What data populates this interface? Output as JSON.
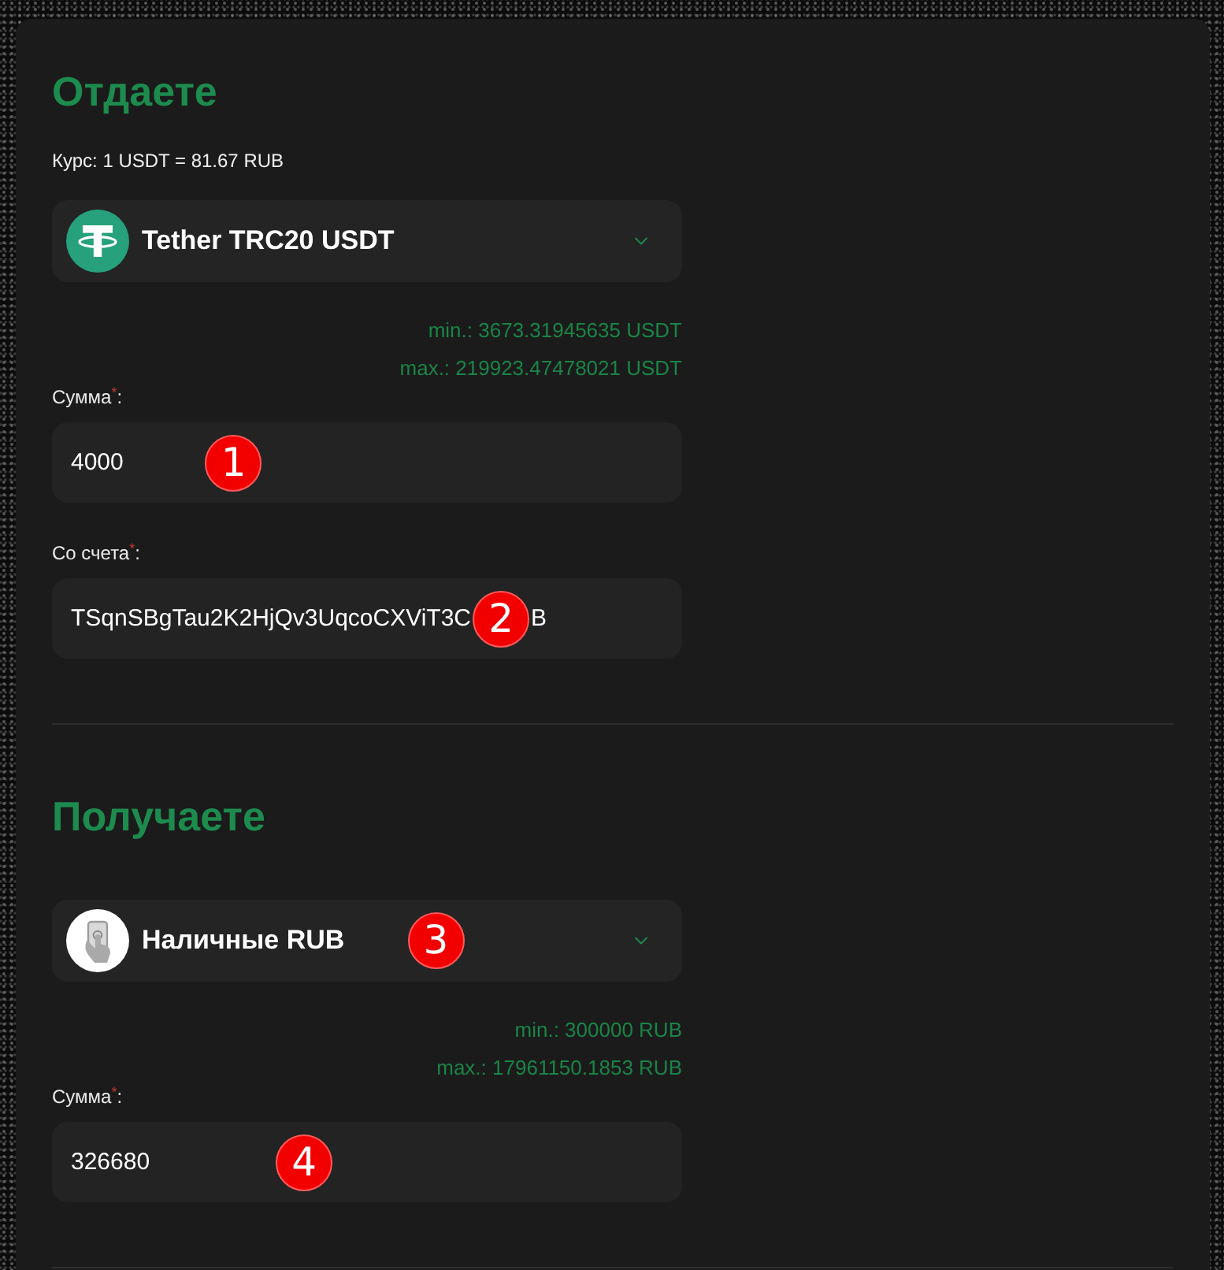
{
  "sections": [
    {
      "title": "Отдаете",
      "rate": "Курс: 1 USDT = 81.67 RUB",
      "currency": {
        "kind": "tether",
        "name": "Tether TRC20 USDT"
      },
      "limits": [
        "min.: 3673.31945635 USDT",
        "max.: 219923.47478021 USDT"
      ],
      "fields": [
        {
          "label": "Сумма$^{*}$:",
          "value": "4000",
          "marker": "1"
        },
        {
          "label": "Со счета$^{*}$:",
          "value": "TSqnSBgTau2K2HjQv3UqcoCXViT3C",
          "value_after_marker": "B",
          "marker": "2"
        }
      ]
    },
    {
      "title": "Получаете",
      "currency": {
        "kind": "cash",
        "name": "Наличные RUB",
        "marker": "3"
      },
      "limits": [
        "min.: 300000 RUB",
        "max.: 17961150.1853 RUB"
      ],
      "fields": [
        {
          "label": "Сумма$^{*}$:",
          "value": "326680",
          "marker": "4"
        }
      ]
    }
  ]
}
